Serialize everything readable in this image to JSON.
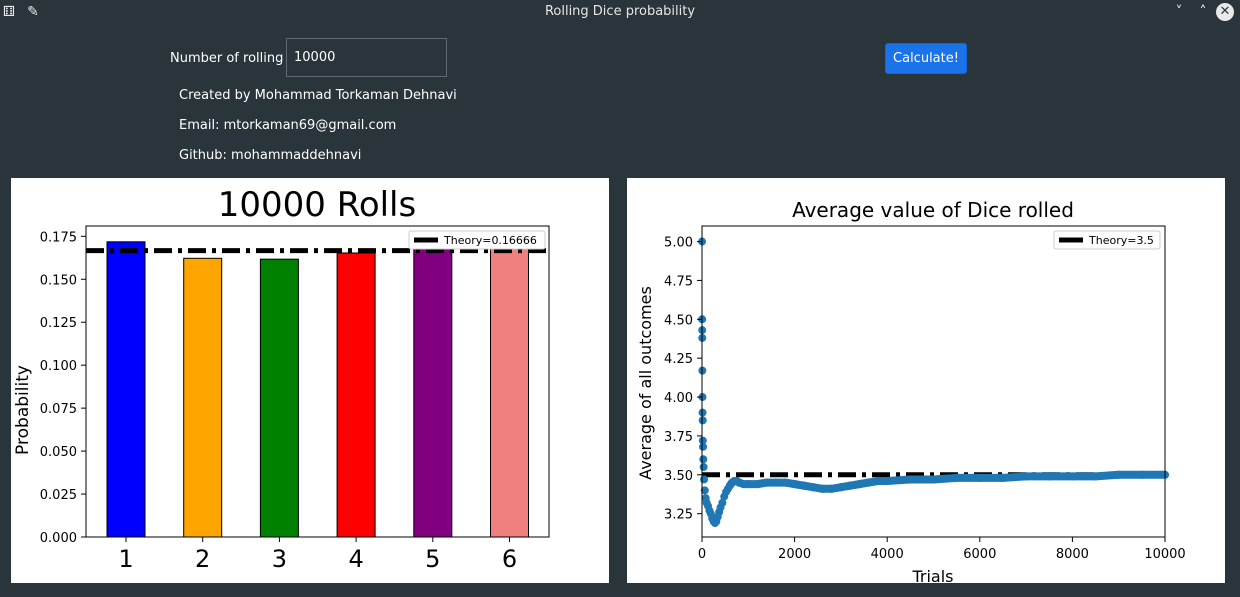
{
  "window": {
    "title": "Rolling Dice probability",
    "app_icon": "dice-icon",
    "pin_icon": "pin-icon",
    "controls": {
      "minimize": "˅",
      "maximize": "˄",
      "close": "✕"
    }
  },
  "form": {
    "rolling_label": "Number of rolling",
    "rolling_value": "10000",
    "calculate_label": "Calculate!"
  },
  "credits": {
    "author": "Created by Mohammad Torkaman Dehnavi",
    "email": "Email: mtorkaman69@gmail.com",
    "github": "Github: mohammaddehnavi"
  },
  "chart_data": [
    {
      "type": "bar",
      "title": "10000 Rolls",
      "xlabel": "",
      "ylabel": "Probability",
      "categories": [
        "1",
        "2",
        "3",
        "4",
        "5",
        "6"
      ],
      "values": [
        0.1718,
        0.1622,
        0.1617,
        0.1653,
        0.1712,
        0.1678
      ],
      "colors": [
        "#0000ff",
        "#ffa500",
        "#008000",
        "#ff0000",
        "#800080",
        "#f08080"
      ],
      "ylim": [
        0,
        0.181
      ],
      "yticks": [
        "0.000",
        "0.025",
        "0.050",
        "0.075",
        "0.100",
        "0.125",
        "0.150",
        "0.175"
      ],
      "reference_line": {
        "value": 0.16666,
        "label": "Theory=0.16666",
        "style": "dash-dot",
        "color": "#000000"
      },
      "legend": "top-right",
      "grid": false
    },
    {
      "type": "scatter",
      "title": "Average value of Dice rolled",
      "xlabel": "Trials",
      "ylabel": "Average of all outcomes",
      "xlim": [
        0,
        10000
      ],
      "ylim": [
        3.1,
        5.1
      ],
      "xticks": [
        "0",
        "2000",
        "4000",
        "6000",
        "8000",
        "10000"
      ],
      "yticks": [
        "3.25",
        "3.50",
        "3.75",
        "4.00",
        "4.25",
        "4.50",
        "4.75",
        "5.00"
      ],
      "series_color": "#1f77b4",
      "points": [
        [
          1,
          5.0
        ],
        [
          3,
          4.5
        ],
        [
          5,
          4.43
        ],
        [
          6,
          4.38
        ],
        [
          8,
          4.17
        ],
        [
          10,
          4.0
        ],
        [
          12,
          3.9
        ],
        [
          15,
          3.85
        ],
        [
          18,
          3.72
        ],
        [
          22,
          3.68
        ],
        [
          28,
          3.6
        ],
        [
          35,
          3.55
        ],
        [
          45,
          3.47
        ],
        [
          60,
          3.4
        ],
        [
          80,
          3.35
        ],
        [
          100,
          3.32
        ],
        [
          130,
          3.3
        ],
        [
          160,
          3.27
        ],
        [
          190,
          3.25
        ],
        [
          220,
          3.22
        ],
        [
          250,
          3.2
        ],
        [
          280,
          3.19
        ],
        [
          310,
          3.2
        ],
        [
          340,
          3.23
        ],
        [
          370,
          3.26
        ],
        [
          400,
          3.29
        ],
        [
          440,
          3.32
        ],
        [
          480,
          3.36
        ],
        [
          520,
          3.39
        ],
        [
          560,
          3.41
        ],
        [
          600,
          3.43
        ],
        [
          650,
          3.45
        ],
        [
          700,
          3.46
        ],
        [
          750,
          3.46
        ],
        [
          800,
          3.45
        ],
        [
          900,
          3.44
        ],
        [
          1000,
          3.44
        ],
        [
          1200,
          3.44
        ],
        [
          1400,
          3.45
        ],
        [
          1600,
          3.45
        ],
        [
          1800,
          3.45
        ],
        [
          2000,
          3.44
        ],
        [
          2200,
          3.43
        ],
        [
          2400,
          3.42
        ],
        [
          2600,
          3.41
        ],
        [
          2800,
          3.41
        ],
        [
          3000,
          3.42
        ],
        [
          3200,
          3.43
        ],
        [
          3400,
          3.44
        ],
        [
          3600,
          3.45
        ],
        [
          3800,
          3.46
        ],
        [
          4000,
          3.46
        ],
        [
          4500,
          3.47
        ],
        [
          5000,
          3.47
        ],
        [
          5500,
          3.48
        ],
        [
          6000,
          3.48
        ],
        [
          6500,
          3.48
        ],
        [
          7000,
          3.49
        ],
        [
          7500,
          3.49
        ],
        [
          8000,
          3.49
        ],
        [
          8500,
          3.49
        ],
        [
          9000,
          3.5
        ],
        [
          9500,
          3.5
        ],
        [
          10000,
          3.5
        ]
      ],
      "reference_line": {
        "value": 3.5,
        "label": "Theory=3.5",
        "style": "dash-dot",
        "color": "#000000"
      },
      "legend": "top-right",
      "grid": false
    }
  ]
}
